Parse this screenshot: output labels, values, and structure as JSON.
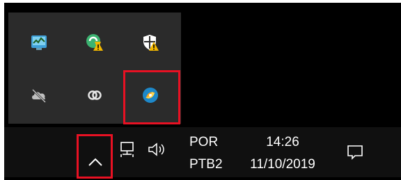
{
  "tray_flyout": {
    "icons": [
      {
        "name": "network-monitor-icon"
      },
      {
        "name": "warning-update-icon"
      },
      {
        "name": "security-warning-icon"
      },
      {
        "name": "cloud-off-icon"
      },
      {
        "name": "creative-cloud-icon"
      },
      {
        "name": "app-swirl-icon"
      }
    ]
  },
  "taskbar": {
    "show_hidden_icons": "show-hidden-icons-chevron",
    "language": {
      "line1": "POR",
      "line2": "PTB2"
    },
    "clock": {
      "time": "14:26",
      "date": "11/10/2019"
    }
  },
  "colors": {
    "highlight": "#e81123",
    "taskbar": "#101010",
    "flyout": "#2b2b2b"
  }
}
